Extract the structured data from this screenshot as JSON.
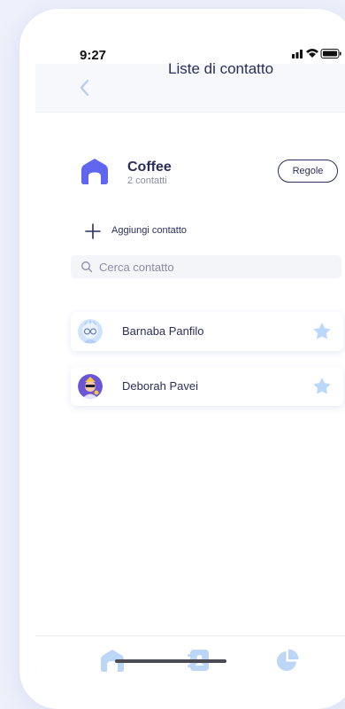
{
  "status_bar": {
    "time": "9:27"
  },
  "header": {
    "title": "Liste di contatto"
  },
  "list": {
    "name": "Coffee",
    "count": "2 contatti",
    "rules_label": "Regole"
  },
  "add_contact": {
    "label": "Aggiungi contatto"
  },
  "search": {
    "placeholder": "Cerca contatto"
  },
  "contacts": [
    {
      "name": "Barnaba Panfilo",
      "favorite": true
    },
    {
      "name": "Deborah Pavei",
      "favorite": true
    }
  ],
  "tabbar": {
    "items": [
      "home-icon",
      "contacts-book-icon",
      "pie-chart-icon"
    ]
  },
  "colors": {
    "accent": "#6066f0",
    "icon_light": "#bcd6f8",
    "star": "#b9d8fb",
    "text": "#2b2e5a"
  }
}
